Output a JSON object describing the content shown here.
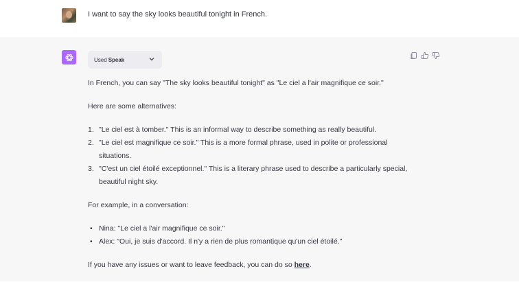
{
  "user_message": {
    "text": "I want to say the sky looks beautiful tonight in French."
  },
  "assistant": {
    "plugin": {
      "used_label": "Used",
      "plugin_name": "Speak",
      "icon": "chevron-down-icon"
    },
    "actions": [
      "copy-icon",
      "thumbs-up-icon",
      "thumbs-down-icon"
    ],
    "intro": "In French, you can say \"The sky looks beautiful tonight\" as \"Le ciel a l'air magnifique ce soir.\"",
    "alternatives_heading": "Here are some alternatives:",
    "alternatives": [
      {
        "number": "1.",
        "text": "\"Le ciel est à tomber.\" This is an informal way to describe something as really beautiful."
      },
      {
        "number": "2.",
        "text": "\"Le ciel est magnifique ce soir.\" This is a more formal phrase, used in polite or professional situations."
      },
      {
        "number": "3.",
        "text": "\"C'est un ciel étoilé exceptionnel.\" This is a literary phrase used to describe a particularly special, beautiful night sky."
      }
    ],
    "example_heading": "For example, in a conversation:",
    "conversation": [
      {
        "text": "Nina: \"Le ciel a l'air magnifique ce soir.\""
      },
      {
        "text": "Alex: \"Oui, je suis d'accord. Il n'y a rien de plus romantique qu'un ciel étoilé.\""
      }
    ],
    "feedback_prefix": "If you have any issues or want to leave feedback, you can do so ",
    "feedback_link": "here",
    "feedback_suffix": "."
  },
  "colors": {
    "gpt_avatar": "#ab68ff",
    "assistant_bg": "#f7f7f8",
    "text": "#343541"
  }
}
